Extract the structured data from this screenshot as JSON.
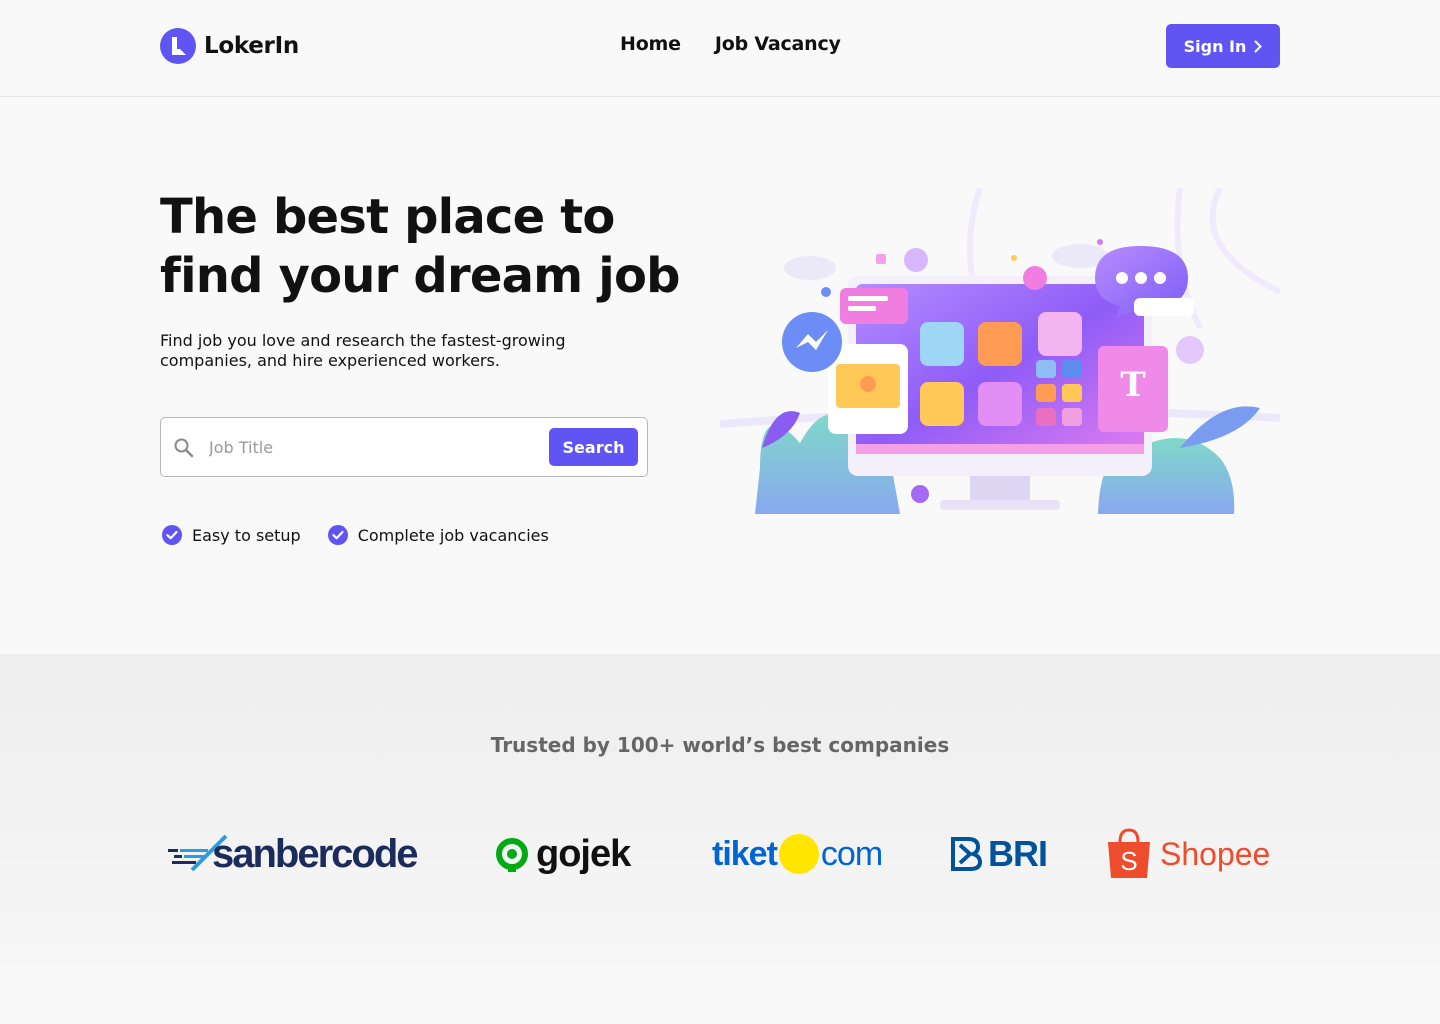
{
  "header": {
    "brand": "LokerIn",
    "nav": [
      {
        "label": "Home"
      },
      {
        "label": "Job Vacancy"
      }
    ],
    "signin_label": "Sign In",
    "accent": "#6055f2"
  },
  "hero": {
    "title": "The best place to find your dream job",
    "subtitle": "Find job you love and research the fastest-growing companies, and hire experienced workers.",
    "search": {
      "placeholder": "Job Title",
      "button_label": "Search"
    },
    "features": [
      {
        "label": "Easy to setup",
        "icon": "check-circle-icon"
      },
      {
        "label": "Complete job vacancies",
        "icon": "check-circle-icon"
      }
    ]
  },
  "trusted": {
    "title": "Trusted by 100+ world’s best companies",
    "companies": [
      {
        "name": "sanbercode",
        "color": "#1a2b5c"
      },
      {
        "name": "gojek",
        "color": "#111111",
        "mark_color": "#00aa13"
      },
      {
        "name": "tiket",
        "suffix": "com",
        "color": "#0064d2",
        "dot_color": "#ffe500"
      },
      {
        "name": "BRI",
        "color": "#00529c"
      },
      {
        "name": "Shopee",
        "color": "#ee4d2d"
      }
    ]
  }
}
